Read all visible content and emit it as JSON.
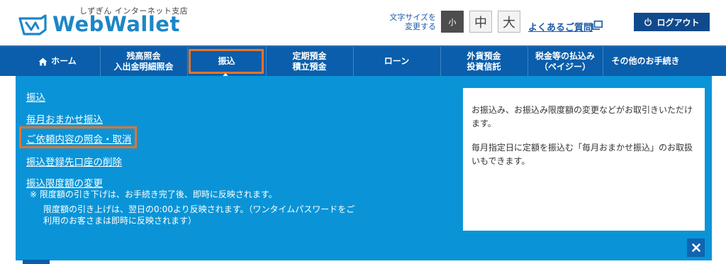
{
  "header": {
    "logo": {
      "subtitle": "しずぎん インターネット支店",
      "name": "WebWallet"
    },
    "font_size": {
      "label_line1": "文字サイズを",
      "label_line2": "変更する",
      "small": "小",
      "medium": "中",
      "large": "大",
      "selected": "小"
    },
    "faq_label": "よくあるご質問",
    "logout_label": "ログアウト"
  },
  "nav": {
    "items": [
      {
        "label": "ホーム"
      },
      {
        "line1": "残高照会",
        "line2": "入出金明細照会"
      },
      {
        "label": "振込"
      },
      {
        "line1": "定期預金",
        "line2": "積立預金"
      },
      {
        "label": "ローン"
      },
      {
        "line1": "外貨預金",
        "line2": "投資信託"
      },
      {
        "line1": "税金等の払込み",
        "line2": "（ペイジー）"
      },
      {
        "label": "その他のお手続き"
      }
    ],
    "active": "振込"
  },
  "panel": {
    "links": [
      "振込",
      "毎月おまかせ振込",
      "ご依頼内容の照会・取消",
      "振込登録先口座の削除",
      "振込限度額の変更"
    ],
    "notes": [
      "※ 限度額の引き下げは、お手続き完了後、即時に反映されます。",
      "限度額の引き上げは、翌日の0:00より反映されます。（ワンタイムパスワードをご",
      "利用のお客さまは即時に反映されます）"
    ],
    "info": {
      "p1_line1": "お振込み、お振込み限度額の変更などがお取引きいただけ",
      "p1_line2": "ます。",
      "p2_line1": "毎月指定日に定額を振込む「毎月おまかせ振込」のお取扱",
      "p2_line2": "いもできます。"
    }
  },
  "colors": {
    "nav_bg": "#0a5eab",
    "panel_bg": "#0a94d7",
    "highlight": "#ee7326",
    "logo_blue": "#1c86c8",
    "logout_bg": "#114a8c"
  },
  "icons": {
    "logo": "wallet-logo-icon",
    "home": "home-icon",
    "faq": "external-window-icon",
    "logout": "power-icon",
    "close": "close-icon"
  }
}
